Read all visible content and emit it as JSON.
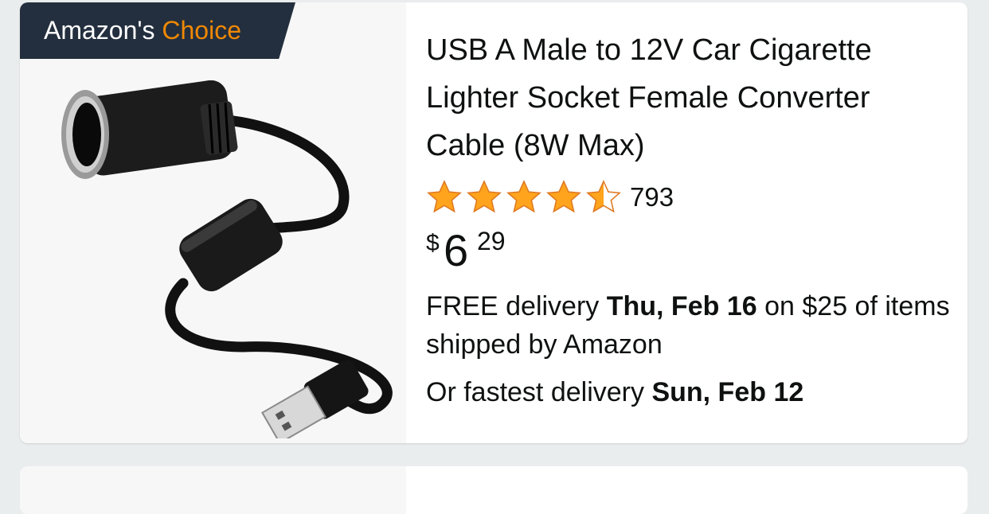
{
  "badge": {
    "prefix": "Amazon's",
    "highlight": "Choice"
  },
  "product": {
    "title": "USB A Male to 12V Car Cigarette Lighter Socket Female Converter Cable (8W Max)",
    "rating": 4.5,
    "rating_count": "793",
    "price": {
      "symbol": "$",
      "whole": "6",
      "fraction": "29"
    },
    "delivery": {
      "text1": "FREE delivery",
      "date": "Thu, Feb 16",
      "text2": "on $25 of items shipped by Amazon"
    },
    "fastest": {
      "text": "Or fastest delivery",
      "date": "Sun, Feb 12"
    }
  },
  "colors": {
    "badge_bg": "#232f3e",
    "badge_accent": "#f08804",
    "star": "#ffa41c",
    "text": "#0f1111"
  },
  "icons": [
    "star-icon",
    "half-star-icon"
  ]
}
